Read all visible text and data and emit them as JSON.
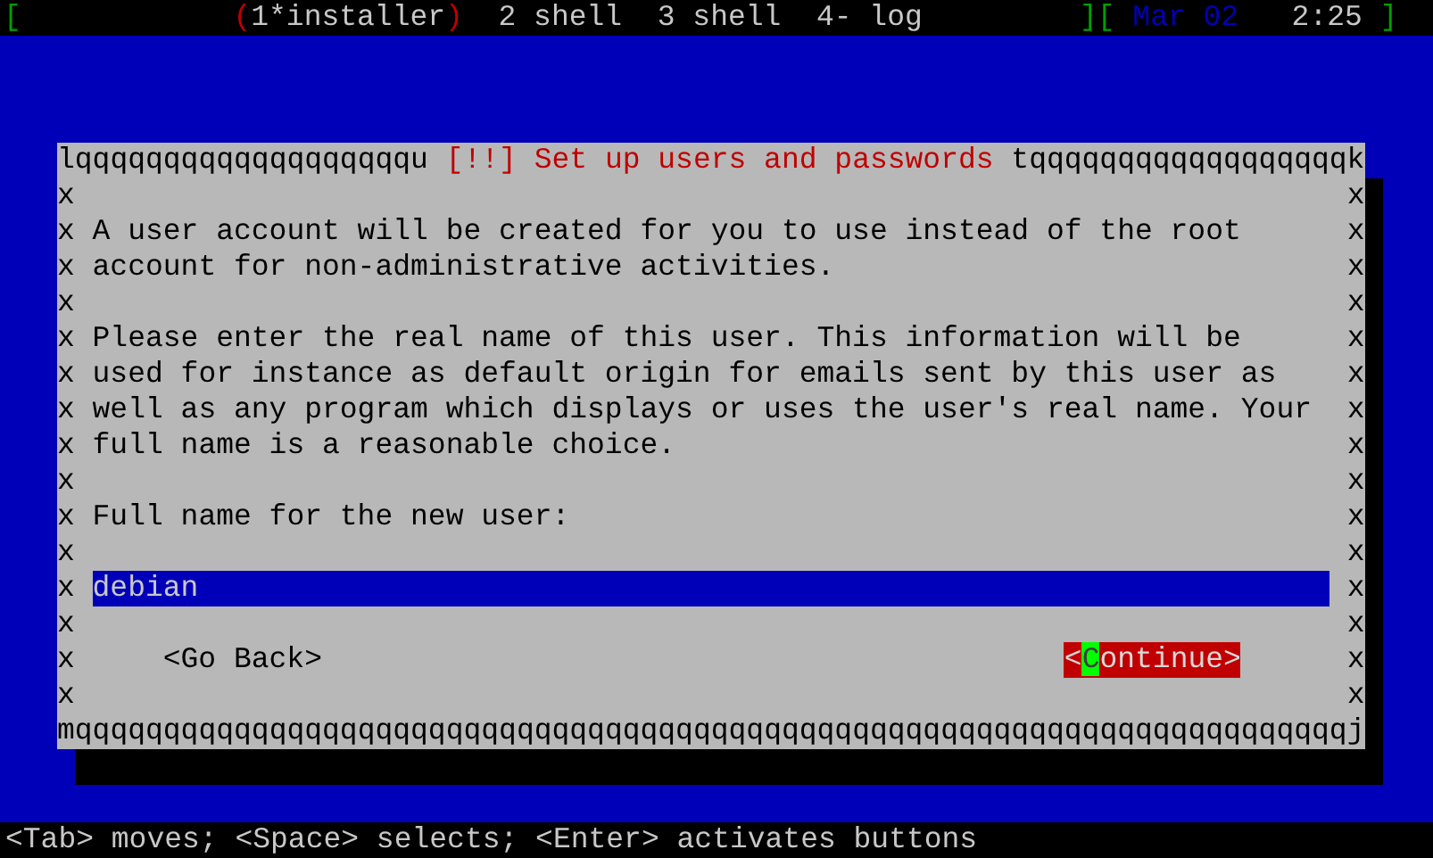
{
  "status_bar": {
    "left_bracket": "[",
    "open_mark": "(",
    "close_mark": ")",
    "windows": [
      {
        "label": "1*installer",
        "selected": true
      },
      {
        "label": "2 shell",
        "selected": false
      },
      {
        "label": "3 shell",
        "selected": false
      },
      {
        "label": "4- log",
        "selected": false
      }
    ],
    "right_brackets": "][",
    "date": "Mar 02",
    "time": "2:25",
    "end_bracket": "]"
  },
  "dialog": {
    "top_left": "lqqqqqqqqqqqqqqqqqqqu",
    "title": "[!!] Set up users and passwords",
    "top_right": "tqqqqqqqqqqqqqqqqqqk",
    "bottom": "mqqqqqqqqqqqqqqqqqqqqqqqqqqqqqqqqqqqqqqqqqqqqqqqqqqqqqqqqqqqqqqqqqqqqqqqqj",
    "left_side": [
      "x",
      "x",
      "x",
      "x",
      "x",
      "x",
      "x",
      "x",
      "x",
      "x",
      "x",
      "x",
      "x",
      "x",
      "x"
    ],
    "right_side": [
      "x",
      "x",
      "x",
      "x",
      "x",
      "x",
      "x",
      "x",
      "x",
      "x",
      "x",
      "x",
      "x",
      "x",
      "x"
    ],
    "blocks": [
      {
        "kind": "paragraph",
        "text": "A user account will be created for you to use instead of the root account for non-administrative activities."
      },
      {
        "kind": "paragraph",
        "text": "Please enter the real name of this user. This information will be used for instance as default origin for emails sent by this user as well as any program which displays or uses the user's real name. Your full name is a reasonable choice."
      },
      {
        "kind": "label",
        "text": "Full name for the new user:"
      },
      {
        "kind": "field",
        "value": "debian"
      },
      {
        "kind": "buttons",
        "buttons": [
          {
            "label": "<Go Back>",
            "selected": false
          },
          {
            "label": "<Continue>",
            "selected": true
          }
        ]
      }
    ]
  },
  "hint": "<Tab> moves; <Space> selects; <Enter> activates buttons"
}
